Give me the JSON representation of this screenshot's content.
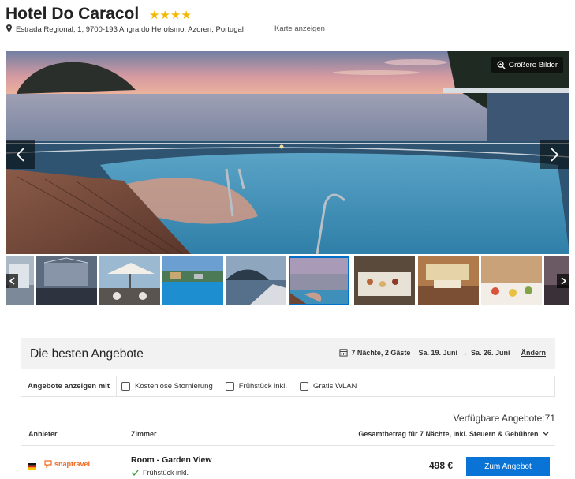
{
  "hotel": {
    "name": "Hotel Do Caracol",
    "stars": "★★★★",
    "address": "Estrada Regional, 1, 9700-193 Angra do Heroísmo, Azoren, Portugal",
    "map_link": "Karte anzeigen"
  },
  "gallery": {
    "bigger_images_label": "Größere Bilder",
    "thumbnail_count": 10,
    "active_thumbnail": 6
  },
  "offers": {
    "title": "Die besten Angebote",
    "stay": "7 Nächte, 2 Gäste",
    "checkin": "Sa. 19. Juni",
    "arrow": "→",
    "checkout": "Sa. 26. Juni",
    "change_link": "Ändern",
    "filter_label": "Angebote anzeigen mit",
    "filters": [
      "Kostenlose Stornierung",
      "Frühstück inkl.",
      "Gratis WLAN"
    ],
    "available_label": "Verfügbare Angebote:71",
    "columns": {
      "provider": "Anbieter",
      "room": "Zimmer",
      "total": "Gesamtbetrag für 7 Nächte, inkl. Steuern & Gebühren"
    },
    "rows": [
      {
        "provider": "snaptravel",
        "room": "Room - Garden View",
        "perk": "Frühstück inkl.",
        "price": "498 €",
        "cta": "Zum Angebot"
      }
    ]
  },
  "colors": {
    "stars": "#f5b800",
    "cta": "#0a74d6",
    "provider": "#f26a22",
    "active_thumb": "#0070c9"
  },
  "icons": [
    "map-pin-icon",
    "zoom-icon",
    "chevron-left-icon",
    "chevron-right-icon",
    "calendar-icon",
    "checkmark-icon",
    "chevron-down-icon",
    "flag-germany-icon"
  ]
}
